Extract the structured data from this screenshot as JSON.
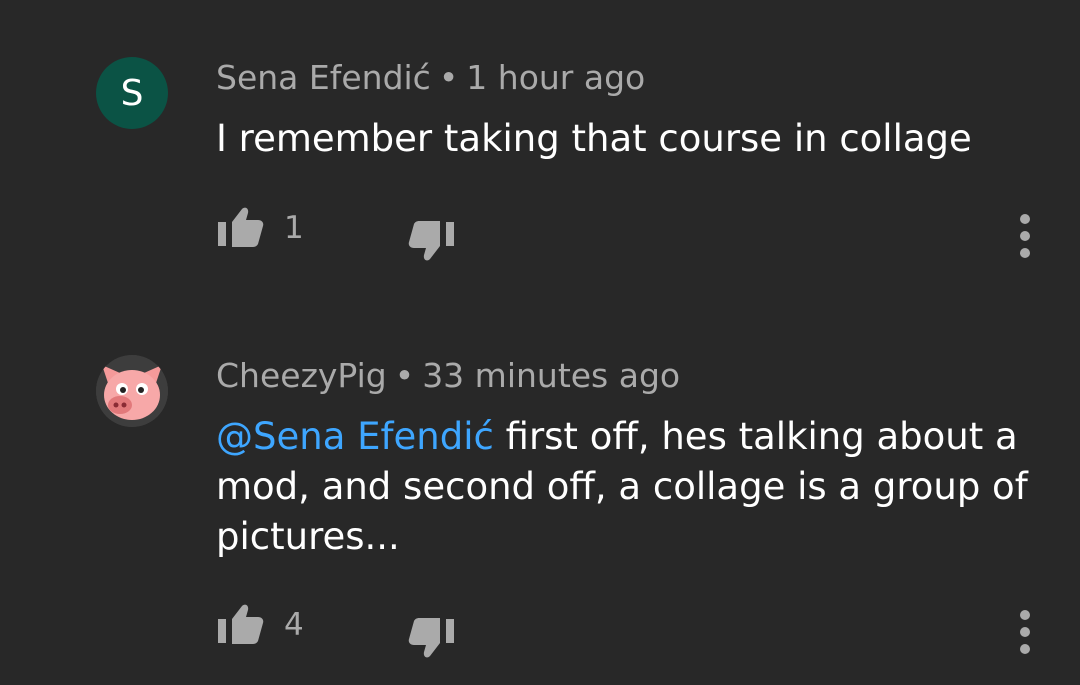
{
  "comments": [
    {
      "avatar_letter": "S",
      "avatar_color": "#0b5345",
      "author": "Sena Efendić",
      "separator": "•",
      "time": "1 hour ago",
      "mention": "",
      "text": "I remember taking that course in collage",
      "likes": "1",
      "like_icon": "thumbs-up-icon",
      "dislike_icon": "thumbs-down-icon",
      "menu_icon": "more-vert-icon"
    },
    {
      "avatar_icon": "pig-avatar",
      "author": "CheezyPig",
      "separator": "•",
      "time": "33 minutes ago",
      "mention": "@Sena Efendić",
      "text": " first off, hes talking about a mod, and second off, a collage is a group of pictures...",
      "likes": "4",
      "like_icon": "thumbs-up-icon",
      "dislike_icon": "thumbs-down-icon",
      "menu_icon": "more-vert-icon"
    }
  ],
  "colors": {
    "background": "#282828",
    "meta_text": "#aaaaaa",
    "body_text": "#ffffff",
    "mention": "#3ea6ff"
  }
}
